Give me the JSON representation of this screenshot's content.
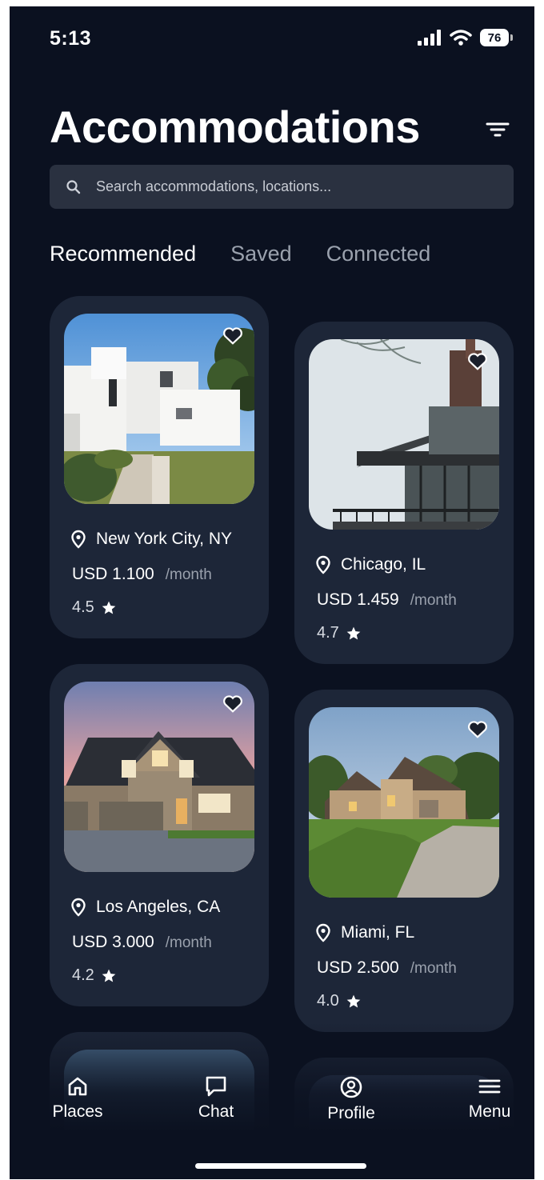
{
  "status_bar": {
    "time": "5:13",
    "battery": "76"
  },
  "header": {
    "title": "Accommodations"
  },
  "search": {
    "placeholder": "Search accommodations, locations..."
  },
  "tabs": [
    {
      "label": "Recommended",
      "active": true
    },
    {
      "label": "Saved",
      "active": false
    },
    {
      "label": "Connected",
      "active": false
    }
  ],
  "listings": [
    {
      "location": "New York City, NY",
      "price": "USD 1.100",
      "unit": "/month",
      "rating": "4.5"
    },
    {
      "location": "Chicago, IL",
      "price": "USD 1.459",
      "unit": "/month",
      "rating": "4.7"
    },
    {
      "location": "Los Angeles, CA",
      "price": "USD 3.000",
      "unit": "/month",
      "rating": "4.2"
    },
    {
      "location": "Miami, FL",
      "price": "USD 2.500",
      "unit": "/month",
      "rating": "4.0"
    }
  ],
  "bottom_nav": [
    {
      "label": "Places",
      "icon": "home-icon"
    },
    {
      "label": "Chat",
      "icon": "chat-icon"
    },
    {
      "label": "Profile",
      "icon": "user-circle-icon"
    },
    {
      "label": "Menu",
      "icon": "menu-icon"
    }
  ],
  "colors": {
    "background": "#0b1120",
    "card": "#1d2638",
    "search": "#2a3140",
    "muted_text": "#9aa1ad"
  }
}
